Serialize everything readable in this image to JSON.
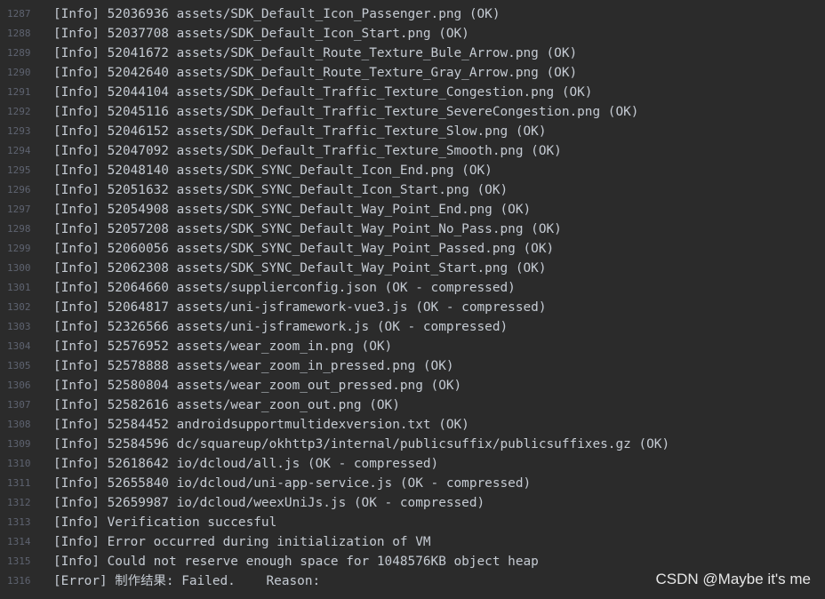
{
  "colors": {
    "background": "#2b2b2b",
    "text": "#c5cbd3",
    "line_number": "#5e6370",
    "watermark": "#e6e6e6"
  },
  "lines": [
    {
      "number": "1287",
      "text": "[Info] 52036936 assets/SDK_Default_Icon_Passenger.png (OK)"
    },
    {
      "number": "1288",
      "text": "[Info] 52037708 assets/SDK_Default_Icon_Start.png (OK)"
    },
    {
      "number": "1289",
      "text": "[Info] 52041672 assets/SDK_Default_Route_Texture_Bule_Arrow.png (OK)"
    },
    {
      "number": "1290",
      "text": "[Info] 52042640 assets/SDK_Default_Route_Texture_Gray_Arrow.png (OK)"
    },
    {
      "number": "1291",
      "text": "[Info] 52044104 assets/SDK_Default_Traffic_Texture_Congestion.png (OK)"
    },
    {
      "number": "1292",
      "text": "[Info] 52045116 assets/SDK_Default_Traffic_Texture_SevereCongestion.png (OK)"
    },
    {
      "number": "1293",
      "text": "[Info] 52046152 assets/SDK_Default_Traffic_Texture_Slow.png (OK)"
    },
    {
      "number": "1294",
      "text": "[Info] 52047092 assets/SDK_Default_Traffic_Texture_Smooth.png (OK)"
    },
    {
      "number": "1295",
      "text": "[Info] 52048140 assets/SDK_SYNC_Default_Icon_End.png (OK)"
    },
    {
      "number": "1296",
      "text": "[Info] 52051632 assets/SDK_SYNC_Default_Icon_Start.png (OK)"
    },
    {
      "number": "1297",
      "text": "[Info] 52054908 assets/SDK_SYNC_Default_Way_Point_End.png (OK)"
    },
    {
      "number": "1298",
      "text": "[Info] 52057208 assets/SDK_SYNC_Default_Way_Point_No_Pass.png (OK)"
    },
    {
      "number": "1299",
      "text": "[Info] 52060056 assets/SDK_SYNC_Default_Way_Point_Passed.png (OK)"
    },
    {
      "number": "1300",
      "text": "[Info] 52062308 assets/SDK_SYNC_Default_Way_Point_Start.png (OK)"
    },
    {
      "number": "1301",
      "text": "[Info] 52064660 assets/supplierconfig.json (OK - compressed)"
    },
    {
      "number": "1302",
      "text": "[Info] 52064817 assets/uni-jsframework-vue3.js (OK - compressed)"
    },
    {
      "number": "1303",
      "text": "[Info] 52326566 assets/uni-jsframework.js (OK - compressed)"
    },
    {
      "number": "1304",
      "text": "[Info] 52576952 assets/wear_zoom_in.png (OK)"
    },
    {
      "number": "1305",
      "text": "[Info] 52578888 assets/wear_zoom_in_pressed.png (OK)"
    },
    {
      "number": "1306",
      "text": "[Info] 52580804 assets/wear_zoom_out_pressed.png (OK)"
    },
    {
      "number": "1307",
      "text": "[Info] 52582616 assets/wear_zoon_out.png (OK)"
    },
    {
      "number": "1308",
      "text": "[Info] 52584452 androidsupportmultidexversion.txt (OK)"
    },
    {
      "number": "1309",
      "text": "[Info] 52584596 dc/squareup/okhttp3/internal/publicsuffix/publicsuffixes.gz (OK)"
    },
    {
      "number": "1310",
      "text": "[Info] 52618642 io/dcloud/all.js (OK - compressed)"
    },
    {
      "number": "1311",
      "text": "[Info] 52655840 io/dcloud/uni-app-service.js (OK - compressed)"
    },
    {
      "number": "1312",
      "text": "[Info] 52659987 io/dcloud/weexUniJs.js (OK - compressed)"
    },
    {
      "number": "1313",
      "text": "[Info] Verification succesful"
    },
    {
      "number": "1314",
      "text": "[Info] Error occurred during initialization of VM"
    },
    {
      "number": "1315",
      "text": "[Info] Could not reserve enough space for 1048576KB object heap"
    },
    {
      "number": "1316",
      "text": "[Error] 制作结果: Failed.    Reason:"
    }
  ],
  "watermark": "CSDN @Maybe it's me"
}
